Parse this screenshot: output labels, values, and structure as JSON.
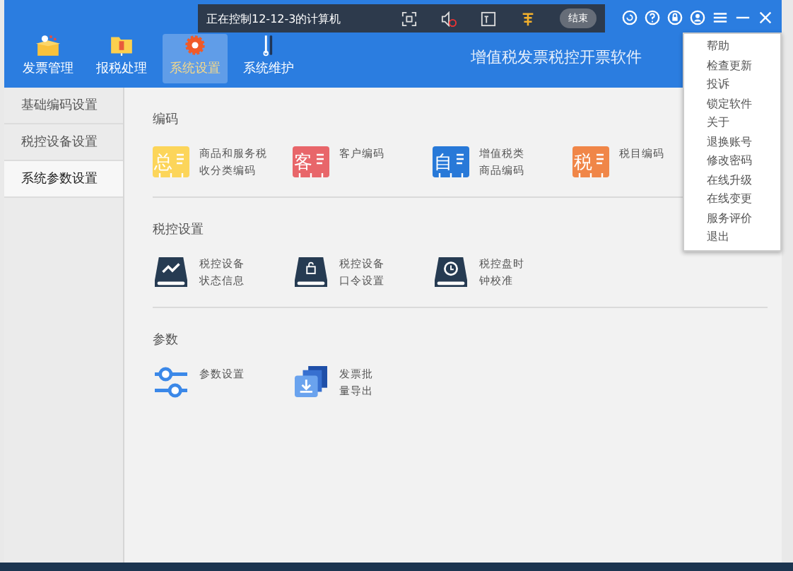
{
  "nav": [
    {
      "label": "发票管理",
      "selected": false
    },
    {
      "label": "报税处理",
      "selected": false
    },
    {
      "label": "系统设置",
      "selected": true
    },
    {
      "label": "系统维护",
      "selected": false
    }
  ],
  "remote_bar": {
    "title": "正在控制12-12-3的计算机",
    "end_button": "结束"
  },
  "app_title": "增值税发票税控开票软件",
  "menu": [
    "帮助",
    "检查更新",
    "投诉",
    "锁定软件",
    "关于",
    "退换账号",
    "修改密码",
    "在线升级",
    "在线变更",
    "服务评价",
    "退出"
  ],
  "sidebar": [
    {
      "label": "基础编码设置",
      "selected": false
    },
    {
      "label": "税控设备设置",
      "selected": false
    },
    {
      "label": "系统参数设置",
      "selected": true
    }
  ],
  "sections": [
    {
      "title": "编码",
      "items": [
        {
          "kind": "badge",
          "glyph": "总",
          "color": "#fcd55a",
          "lines": [
            "商品和服务税",
            "收分类编码"
          ]
        },
        {
          "kind": "badge",
          "glyph": "客",
          "color": "#e8666a",
          "lines": [
            "客户编码"
          ]
        },
        {
          "kind": "badge",
          "glyph": "自",
          "color": "#2879d8",
          "lines": [
            "增值税类",
            "商品编码"
          ]
        },
        {
          "kind": "badge",
          "glyph": "税",
          "color": "#f08648",
          "lines": [
            "税目编码"
          ]
        }
      ]
    },
    {
      "title": "税控设置",
      "items": [
        {
          "kind": "disk-chart",
          "lines": [
            "税控设备",
            "状态信息"
          ]
        },
        {
          "kind": "disk-lock",
          "lines": [
            "税控设备",
            "口令设置"
          ]
        },
        {
          "kind": "disk-clock",
          "lines": [
            "税控盘时",
            "钟校准"
          ]
        }
      ]
    },
    {
      "title": "参数",
      "items": [
        {
          "kind": "sliders",
          "lines": [
            "参数设置"
          ]
        },
        {
          "kind": "export",
          "lines": [
            "发票批",
            "量导出"
          ]
        }
      ]
    }
  ]
}
